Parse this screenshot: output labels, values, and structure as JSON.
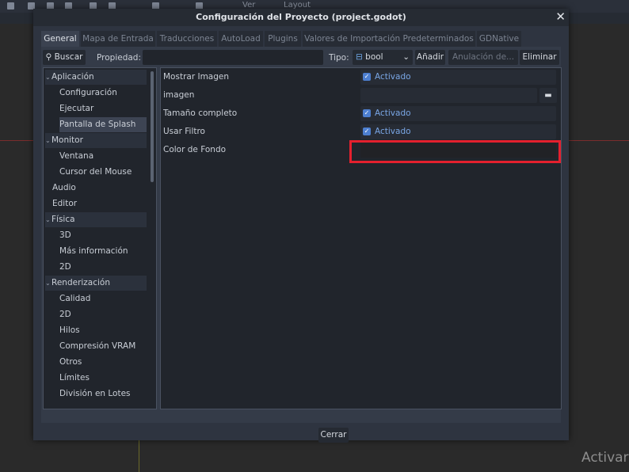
{
  "background_editor": {
    "toolbar_items": [
      "Ver",
      "Layout"
    ],
    "watermark": "Activar"
  },
  "dialog": {
    "title": "Configuración del Proyecto (project.godot)",
    "close_glyph": "✕",
    "tabs": [
      {
        "label": "General",
        "active": true
      },
      {
        "label": "Mapa de Entrada"
      },
      {
        "label": "Traducciones"
      },
      {
        "label": "AutoLoad"
      },
      {
        "label": "Plugins"
      },
      {
        "label": "Valores de Importación Predeterminados"
      },
      {
        "label": "GDNative"
      }
    ],
    "search_button": "Buscar",
    "property_label": "Propiedad:",
    "property_value": "",
    "type_label": "Tipo:",
    "type_value": "bool",
    "add_button": "Añadir",
    "override_button": "Anulación de...",
    "delete_button": "Eliminar",
    "tree": [
      {
        "label": "Aplicación",
        "section": true
      },
      {
        "label": "Configuración"
      },
      {
        "label": "Ejecutar"
      },
      {
        "label": "Pantalla de Splash",
        "selected": true
      },
      {
        "label": "Monitor",
        "section": true
      },
      {
        "label": "Ventana"
      },
      {
        "label": "Cursor del Mouse"
      },
      {
        "label": "Audio",
        "category": true
      },
      {
        "label": "Editor",
        "category": true
      },
      {
        "label": "Física",
        "section": true
      },
      {
        "label": "3D"
      },
      {
        "label": "Más información"
      },
      {
        "label": "2D"
      },
      {
        "label": "Renderización",
        "section": true
      },
      {
        "label": "Calidad"
      },
      {
        "label": "2D"
      },
      {
        "label": "Hilos"
      },
      {
        "label": "Compresión VRAM"
      },
      {
        "label": "Otros"
      },
      {
        "label": "Límites"
      },
      {
        "label": "División en Lotes"
      }
    ],
    "properties": [
      {
        "label": "Mostrar Imagen",
        "type": "checkbox",
        "checked": true,
        "value_text": "Activado"
      },
      {
        "label": "imagen",
        "type": "file",
        "value_text": ""
      },
      {
        "label": "Tamaño completo",
        "type": "checkbox",
        "checked": true,
        "value_text": "Activado"
      },
      {
        "label": "Usar Filtro",
        "type": "checkbox",
        "checked": true,
        "value_text": "Activado"
      },
      {
        "label": "Color de Fondo",
        "type": "color",
        "value_text": ""
      }
    ],
    "footer_close": "Cerrar"
  },
  "colors": {
    "accent": "#4d7fd0",
    "highlight": "#e4202e",
    "panel": "#2e3440",
    "field": "#21252c"
  },
  "icons": {
    "search": "magnifier-icon",
    "type": "bool-type-icon",
    "dropdown": "chevron-down-icon",
    "folder": "folder-icon",
    "check": "checkbox-checked-icon",
    "close": "close-icon"
  }
}
